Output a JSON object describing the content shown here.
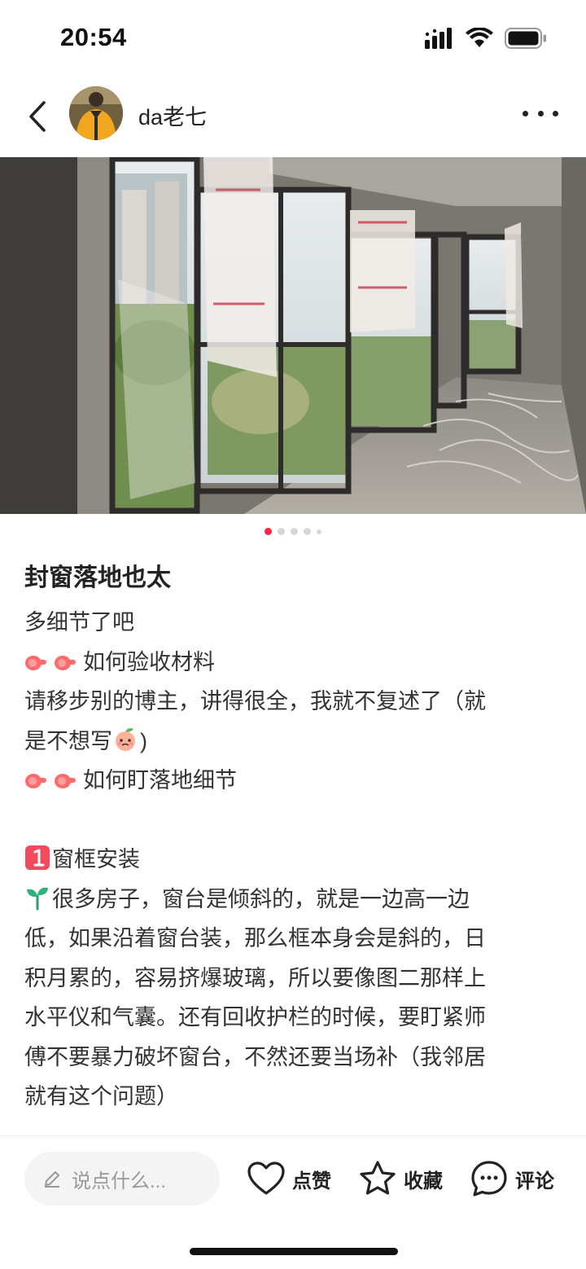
{
  "status_bar": {
    "time": "20:54"
  },
  "header": {
    "username": "da老七"
  },
  "carousel": {
    "total": 5,
    "current": 1
  },
  "post": {
    "title": "封窗落地也太",
    "lines": [
      "多细节了吧",
      "如何验收材料",
      "请移步别的博主，讲得很全，我就不复述了（就",
      "是不想写",
      ")",
      "如何盯落地细节",
      "窗框安装",
      "很多房子，窗台是倾斜的，就是一边高一边",
      "低，如果沿着窗台装，那么框本身会是斜的，日",
      "积月累的，容易挤爆玻璃，所以要像图二那样上",
      "水平仪和气囊。还有回收护栏的时候，要盯紧师",
      "傅不要暴力破坏窗台，不然还要当场补（我邻居",
      "就有这个问题）"
    ]
  },
  "bottom_bar": {
    "comment_placeholder": "说点什么...",
    "like_label": "点赞",
    "collect_label": "收藏",
    "comment_label": "评论"
  },
  "colors": {
    "accent": "#ff2442",
    "text": "#333333",
    "input_bg": "#f4f4f4"
  }
}
